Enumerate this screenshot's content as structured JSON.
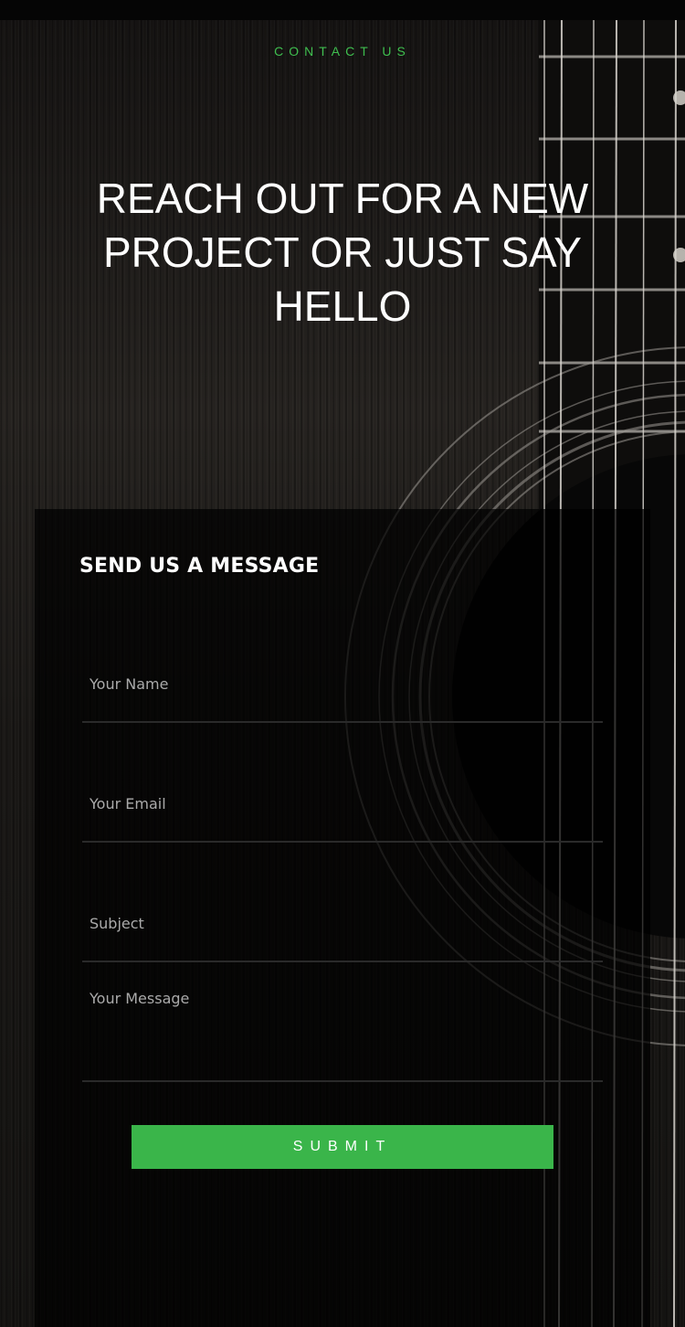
{
  "hero": {
    "eyebrow": "CONTACT US",
    "headline": "REACH OUT FOR A NEW PROJECT OR JUST SAY HELLO"
  },
  "form": {
    "title": "SEND US A MESSAGE",
    "name_placeholder": "Your Name",
    "email_placeholder": "Your Email",
    "subject_placeholder": "Subject",
    "message_placeholder": "Your Message",
    "submit_label": "SUBMIT"
  },
  "colors": {
    "accent": "#3ab54a",
    "eyebrow": "#3fbf4f",
    "background": "#1a1816",
    "panel": "rgba(0,0,0,0.72)"
  }
}
